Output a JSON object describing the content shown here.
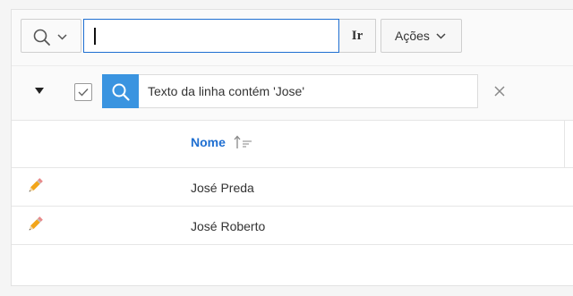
{
  "toolbar": {
    "search_icon": "search-icon",
    "search_value": "",
    "go_label": "Ir",
    "actions_label": "Ações"
  },
  "filter": {
    "text": "Texto da linha contém 'Jose'"
  },
  "grid": {
    "column_header": "Nome",
    "sort": "ascending",
    "rows": [
      {
        "name": "José Preda"
      },
      {
        "name": "José Roberto"
      }
    ]
  },
  "colors": {
    "accent": "#1f6fd1",
    "filter_icon_bg": "#3a94e0",
    "pencil": "#f2a51a"
  }
}
